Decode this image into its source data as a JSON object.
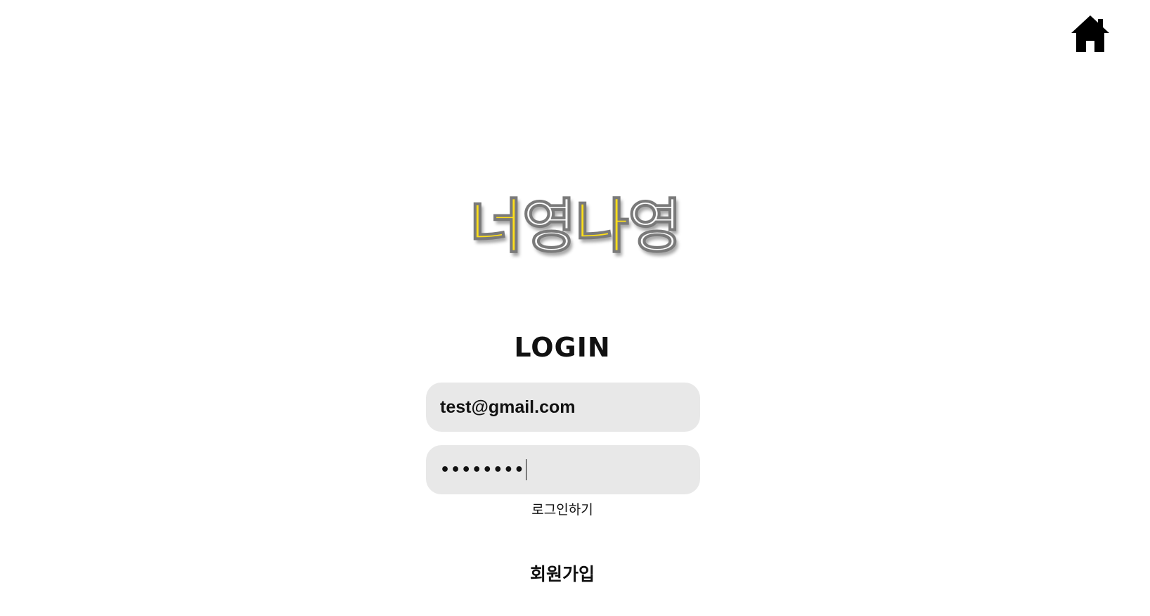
{
  "header": {
    "home_icon": "home-icon"
  },
  "logo": {
    "part1": "너",
    "part2": "영",
    "part3": "나",
    "part4": "영",
    "colors": {
      "yellow": "#ffdf1a",
      "white": "#ffffff"
    }
  },
  "login": {
    "title": "LOGIN",
    "email_value": "test@gmail.com",
    "password_mask": "••••••••",
    "submit_label": "로그인하기",
    "signup_label": "회원가입"
  },
  "colors": {
    "field_background": "#e8e8e8",
    "text": "#111111"
  }
}
